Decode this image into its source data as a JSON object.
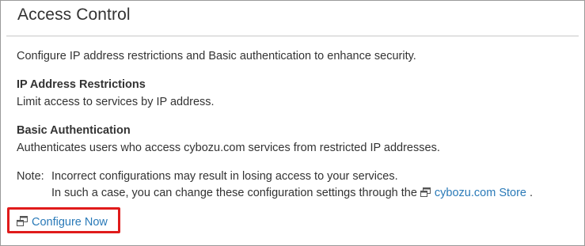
{
  "panel": {
    "title": "Access Control",
    "intro": "Configure IP address restrictions and Basic authentication to enhance security."
  },
  "sections": [
    {
      "heading": "IP Address Restrictions",
      "body": "Limit access to services by IP address."
    },
    {
      "heading": "Basic Authentication",
      "body": "Authenticates users who access cybozu.com services from restricted IP addresses."
    }
  ],
  "note": {
    "label": "Note:",
    "line1": "Incorrect configurations may result in losing access to your services.",
    "line2_prefix": "In such a case, you can change these configuration settings through the",
    "store_link": "cybozu.com Store",
    "line2_suffix": "."
  },
  "action": {
    "configure_label": "Configure Now",
    "icon": "external-window-icon"
  },
  "colors": {
    "link": "#2a7ab8",
    "highlight": "#e01b1b",
    "text": "#333333",
    "border": "#9a9a9a"
  }
}
